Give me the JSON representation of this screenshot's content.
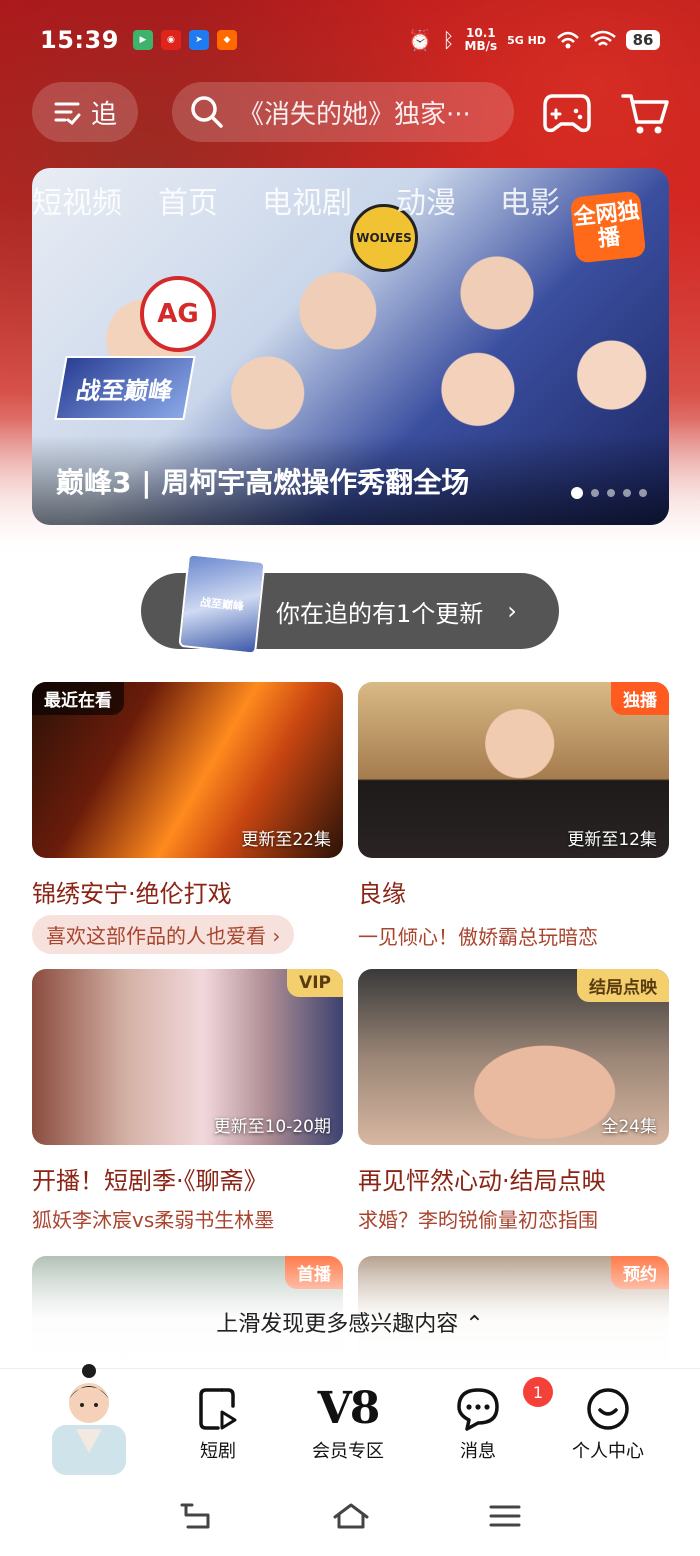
{
  "status_bar": {
    "time": "15:39",
    "net_speed_value": "10.1",
    "net_speed_unit": "MB/s",
    "network": "5G HD",
    "battery": "86",
    "apps": [
      {
        "name": "iqiyi-app",
        "color": "#3db36b"
      },
      {
        "name": "weibo-app",
        "color": "#e1241b"
      },
      {
        "name": "pin-app",
        "color": "#1e7bf2"
      },
      {
        "name": "taobao-app",
        "color": "#ff6a00"
      }
    ]
  },
  "topbar": {
    "follow_label": "追",
    "search_placeholder": "《消失的她》独家···"
  },
  "banner": {
    "tabs": [
      "短视频",
      "首页",
      "电视剧",
      "动漫",
      "电影"
    ],
    "badge": "全网独播",
    "caption": "巅峰3 | 周柯宇高燃操作秀翻全场",
    "logo_ag": "AG",
    "logo_wolves": "WOLVES",
    "show_logo": "战至巅峰"
  },
  "following_update": {
    "text": "你在追的有1个更新",
    "arrow": "›"
  },
  "cards": [
    {
      "tag": "最近在看",
      "episodes": "更新至22集",
      "title": "锦绣安宁·绝伦打戏",
      "subtitle": "喜欢这部作品的人也爱看 ›"
    },
    {
      "tag": "独播",
      "episodes": "更新至12集",
      "title": "良缘",
      "subtitle": "一见倾心！傲娇霸总玩暗恋"
    },
    {
      "tag": "VIP",
      "episodes": "更新至10-20期",
      "title": "开播！短剧季·《聊斋》",
      "subtitle": "狐妖李沐宸vs柔弱书生林墨"
    },
    {
      "tag": "结局点映",
      "episodes": "全24集",
      "title": "再见怦然心动·结局点映",
      "subtitle": "求婚？李昀锐偷量初恋指围"
    },
    {
      "tag": "首播"
    },
    {
      "tag": "预约"
    }
  ],
  "discover_more": "上滑发现更多感兴趣内容 ⌃",
  "bottom_nav": {
    "items": [
      {
        "label": "短剧"
      },
      {
        "label": "会员专区",
        "icon_text": "V8"
      },
      {
        "label": "消息",
        "badge": "1"
      },
      {
        "label": "个人中心"
      }
    ]
  },
  "colors": {
    "brand_red": "#c81b1f",
    "title_red": "#8a2415",
    "badge_orange": "#ff5a1f",
    "vip_gold": "#f3cf6e"
  }
}
